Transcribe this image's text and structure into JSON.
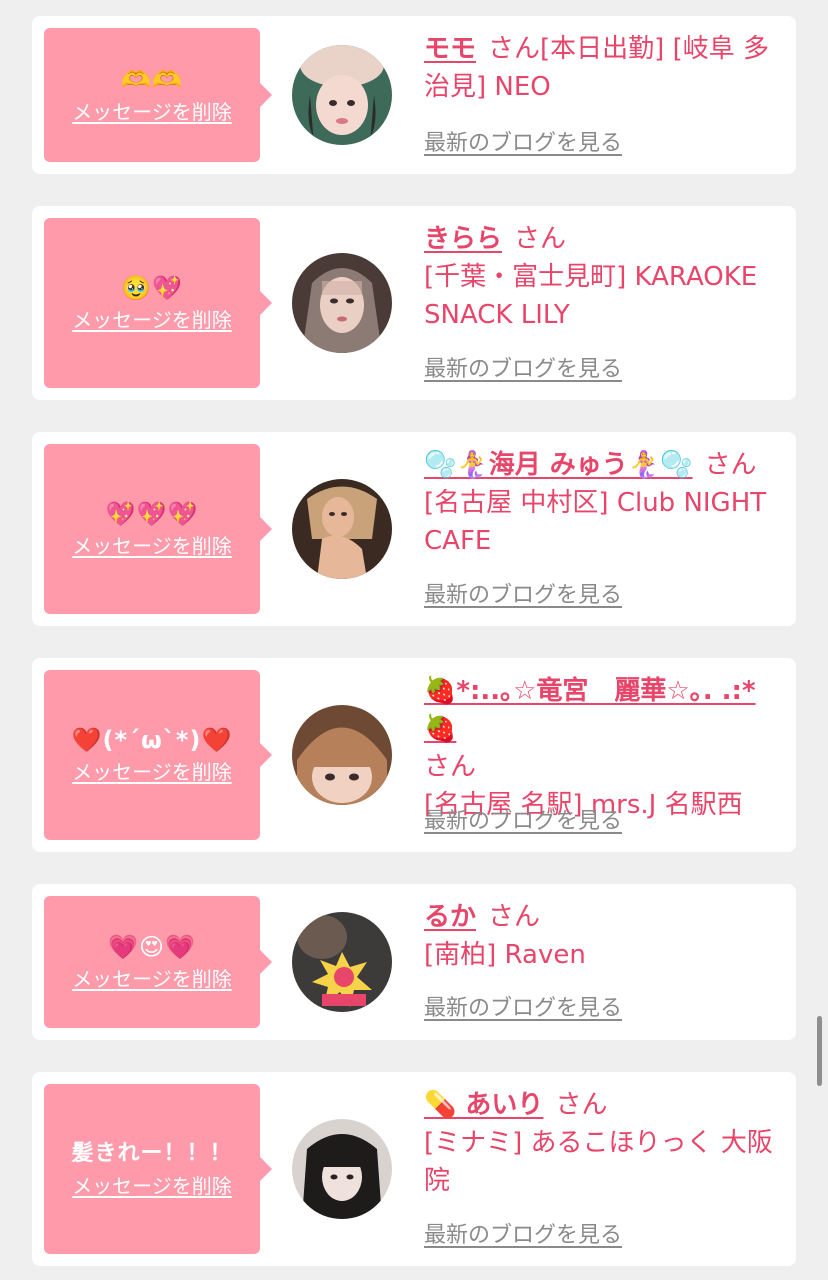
{
  "common": {
    "delete_label": "メッセージを削除",
    "blog_label": "最新のブログを見る",
    "honorific": "さん"
  },
  "messages": [
    {
      "message": "🫶🫶",
      "name": "モモ",
      "shop": "[本日出勤] [岐阜 多治見] NEO",
      "avatar_colors": [
        "#3e6a5a",
        "#f3d9cf",
        "#2b2b2b"
      ]
    },
    {
      "message": "🥹💖",
      "name": "きらら",
      "shop": "[千葉・富士見町] KARAOKE SNACK LILY",
      "avatar_colors": [
        "#4a3b36",
        "#e9cfc4",
        "#8c7a74"
      ]
    },
    {
      "message": "💖💖💖",
      "name": "🫧🧜‍♀️海月 みゅう🧜‍♀️🫧",
      "shop": "[名古屋 中村区] Club NIGHT CAFE",
      "avatar_colors": [
        "#3a2a22",
        "#e7b79a",
        "#c9a27a"
      ]
    },
    {
      "message": "❤️(*´ω`*)❤️",
      "name": "🍓*:..｡☆竜宮　麗華☆｡. .:*🍓",
      "shop": "[名古屋 名駅] mrs.J 名駅西",
      "avatar_colors": [
        "#b5805a",
        "#f1d2c2",
        "#6e4a35"
      ]
    },
    {
      "message": "💗😍💗",
      "name": "るか",
      "shop": "[南柏] Raven",
      "avatar_colors": [
        "#3d3a3a",
        "#f7d34a",
        "#e8456a"
      ]
    },
    {
      "message": "髪きれー！！！",
      "name": "💊 あいり",
      "shop": "[ミナミ] あるこほりっく 大阪院",
      "avatar_colors": [
        "#d9d3d0",
        "#1e1b1b",
        "#efe2dc"
      ]
    }
  ]
}
